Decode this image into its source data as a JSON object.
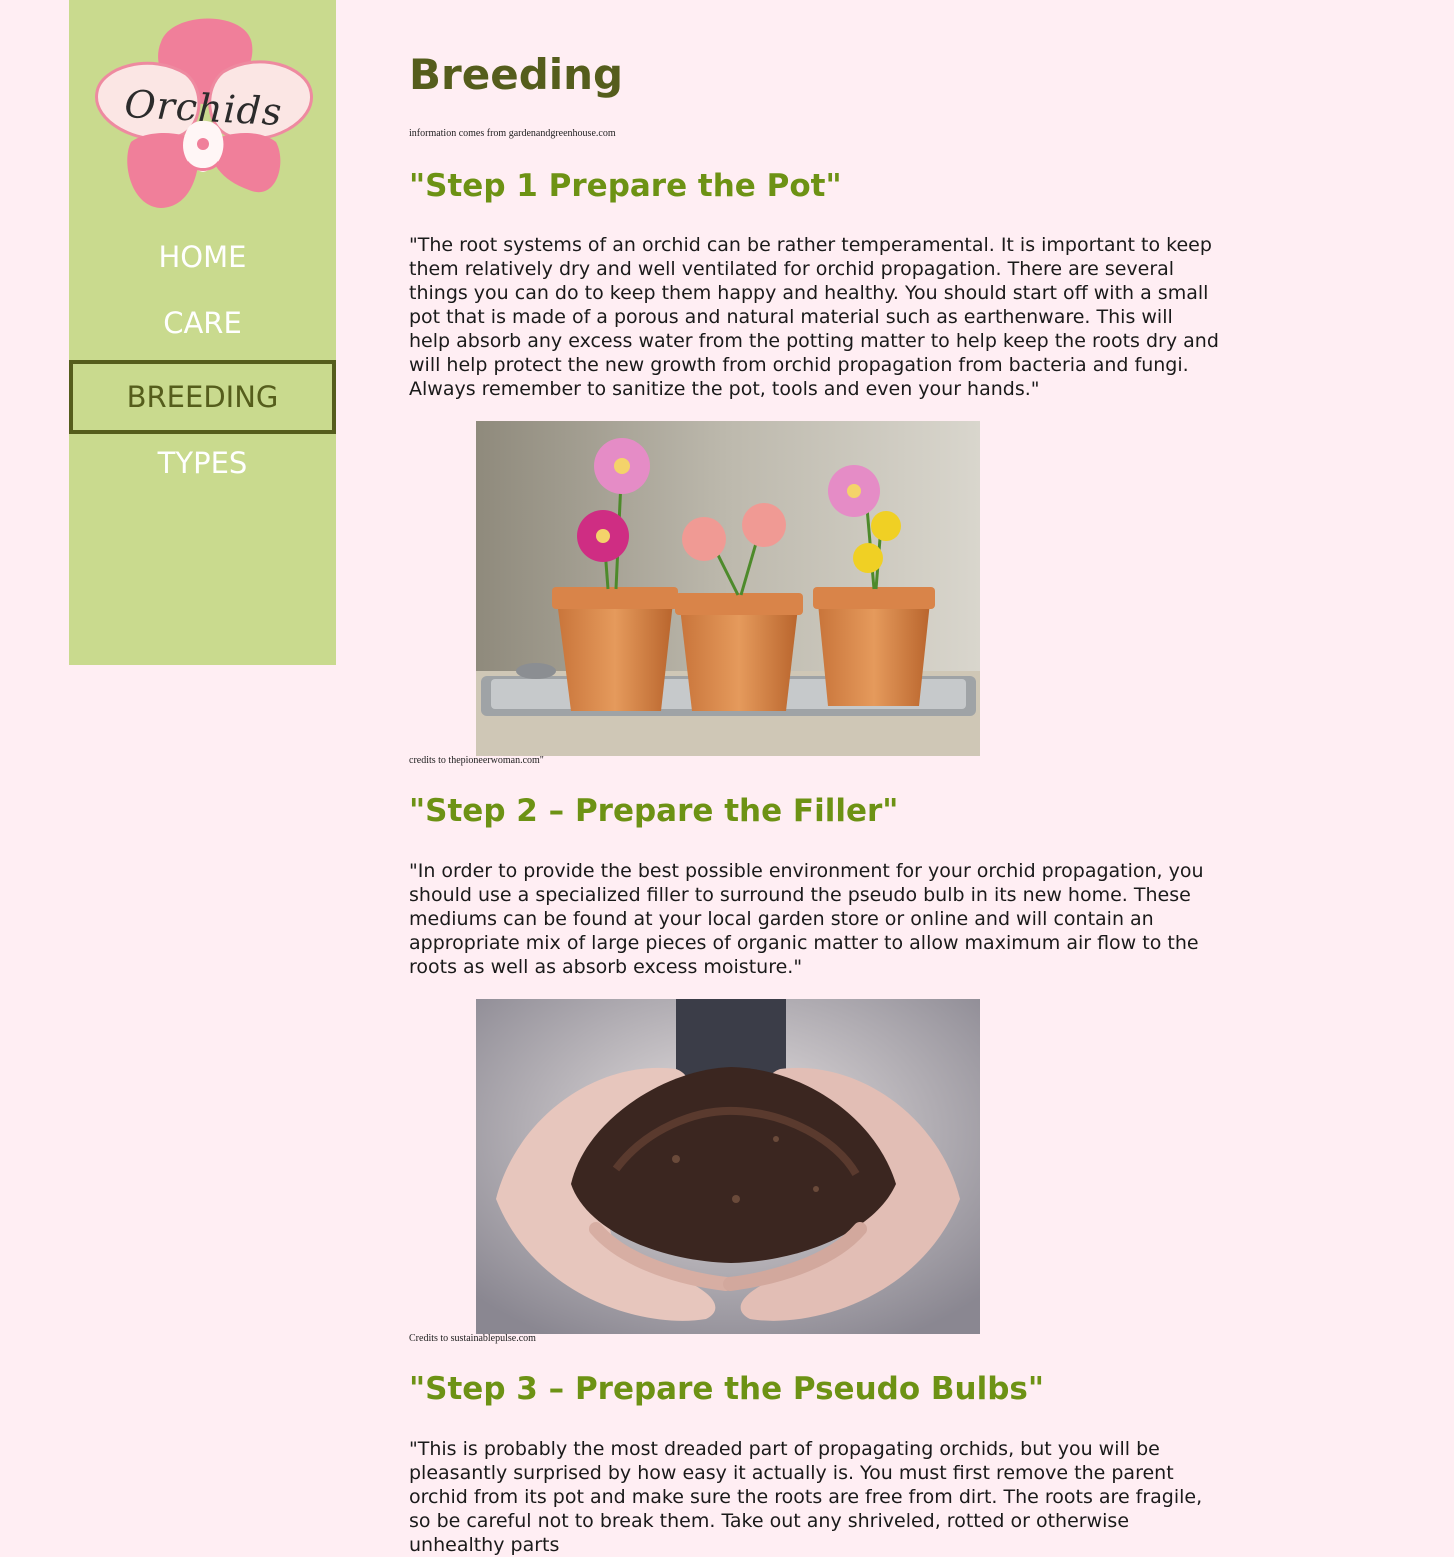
{
  "logo": {
    "text": "Orchids"
  },
  "nav": {
    "items": [
      {
        "label": "HOME",
        "active": false
      },
      {
        "label": "CARE",
        "active": false
      },
      {
        "label": "BREEDING",
        "active": true
      },
      {
        "label": "TYPES",
        "active": false
      }
    ]
  },
  "page": {
    "title": "Breeding",
    "source_note": "information comes from gardenandgreenhouse.com"
  },
  "steps": [
    {
      "heading": "\"Step 1 Prepare the Pot\"",
      "text": "\"The root systems of an orchid can be rather temperamental. It is important to keep them relatively dry and well ventilated for orchid propagation. There are several things you can do to keep them happy and healthy. You should start off with a small pot that is made of a porous and natural material such as earthenware. This will help absorb any excess water from the potting matter to help keep the roots dry and will help protect the new growth from orchid propagation from bacteria and fungi. Always remember to sanitize the pot, tools and even your hands.\"",
      "image": "flower-pots-photo",
      "credit": "credits to thepioneerwoman.com\""
    },
    {
      "heading": "\"Step 2 – Prepare the Filler\"",
      "text": "\"In order to provide the best possible environment for your orchid propagation, you should use a specialized filler to surround the pseudo bulb in its new home. These mediums can be found at your local garden store or online and will contain an appropriate mix of large pieces of organic matter to allow maximum air flow to the roots as well as absorb excess moisture.\"",
      "image": "soil-hands-photo",
      "credit": "Credits to sustainablepulse.com"
    },
    {
      "heading": "\"Step 3 – Prepare the Pseudo Bulbs\"",
      "text": "\"This is probably the most dreaded part of propagating orchids, but you will be pleasantly surprised by how easy it actually is. You must first remove the parent orchid from its pot and make sure the roots are free from dirt. The roots are fragile, so be careful not to break them. Take out any shriveled, rotted or otherwise unhealthy parts"
    }
  ],
  "colors": {
    "background": "#ffeef3",
    "sidebar": "#c9da8e",
    "title": "#555d1c",
    "heading": "#6d9214",
    "nav_text": "#ffffff"
  }
}
